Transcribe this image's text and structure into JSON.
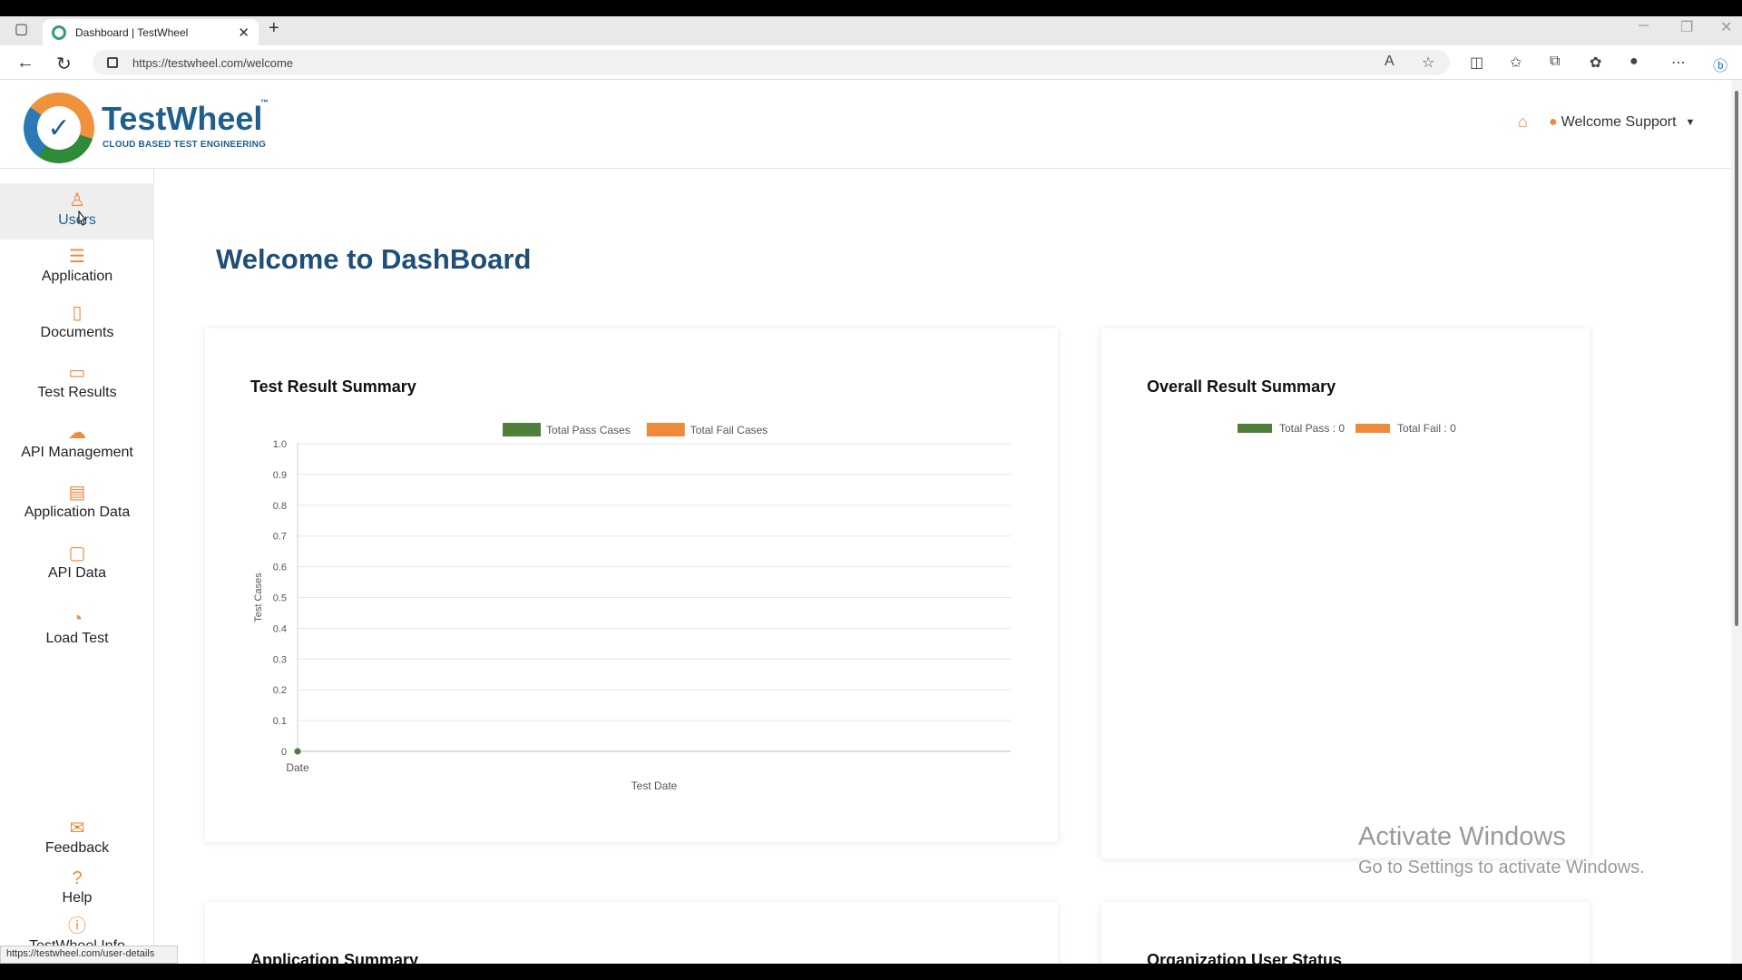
{
  "browser": {
    "tab_title": "Dashboard | TestWheel",
    "url": "https://testwheel.com/welcome",
    "status_url": "https://testwheel.com/user-details"
  },
  "header": {
    "logo_text": "TestWheel",
    "logo_tm": "™",
    "logo_subtitle": "CLOUD BASED TEST ENGINEERING",
    "user_label": "Welcome Support"
  },
  "sidebar": {
    "items": [
      {
        "label": "Users",
        "icon": "user-icon"
      },
      {
        "label": "Application",
        "icon": "list-icon"
      },
      {
        "label": "Documents",
        "icon": "document-icon"
      },
      {
        "label": "Test Results",
        "icon": "briefcase-icon"
      },
      {
        "label": "API Management",
        "icon": "cloud-gear-icon"
      },
      {
        "label": "Application Data",
        "icon": "table-icon"
      },
      {
        "label": "API Data",
        "icon": "monitor-icon"
      },
      {
        "label": "Load Test",
        "icon": "gauge-icon"
      }
    ],
    "bottom_items": [
      {
        "label": "Feedback",
        "icon": "chat-icon"
      },
      {
        "label": "Help",
        "icon": "question-icon"
      },
      {
        "label": "TestWheel Info",
        "icon": "info-icon"
      }
    ]
  },
  "main": {
    "title": "Welcome to DashBoard",
    "cards": {
      "test_result_summary": "Test Result Summary",
      "overall_result_summary": "Overall Result Summary",
      "application_summary": "Application Summary",
      "organization_user_status": "Organization User Status"
    }
  },
  "overall_legend": {
    "pass": "Total Pass : 0",
    "fail": "Total Fail : 0"
  },
  "colors": {
    "brand": "#1f5f8b",
    "accent": "#ef8a3d",
    "pass": "#4f7f3a",
    "fail": "#ef8a3d"
  },
  "chart_data": {
    "type": "line",
    "title": "Test Result Summary",
    "xlabel": "Test Date",
    "ylabel": "Test Cases",
    "categories": [
      "Date"
    ],
    "series": [
      {
        "name": "Total Pass Cases",
        "values": [
          0
        ]
      },
      {
        "name": "Total Fail Cases",
        "values": [
          0
        ]
      }
    ],
    "ylim": [
      0,
      1.0
    ],
    "yticks": [
      0,
      0.1,
      0.2,
      0.3,
      0.4,
      0.5,
      0.6,
      0.7,
      0.8,
      0.9,
      1.0
    ],
    "grid": true,
    "legend": "top-center"
  },
  "watermark": {
    "line1": "Activate Windows",
    "line2": "Go to Settings to activate Windows."
  }
}
